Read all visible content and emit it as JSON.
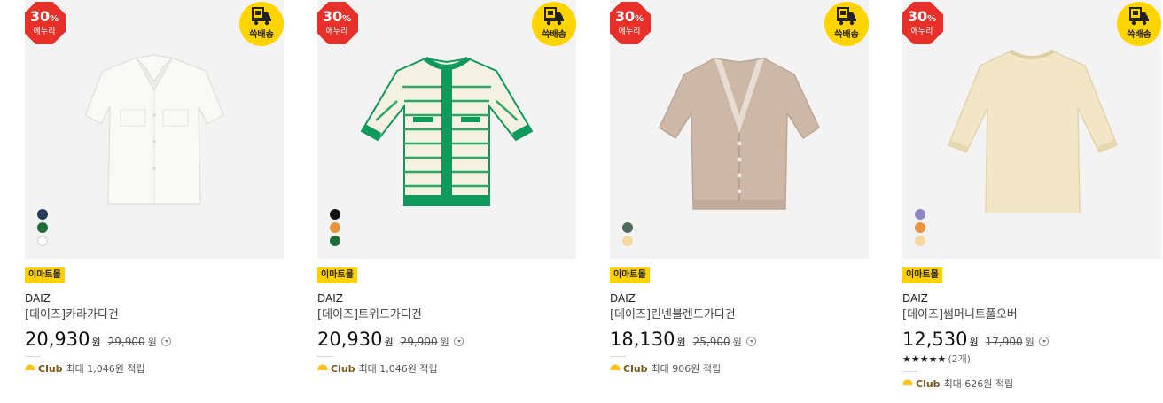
{
  "products": [
    {
      "sale_pct": "30",
      "sale_unit": "%",
      "sale_label": "에누리",
      "ship_label": "쓱배송",
      "mall_label": "이마트몰",
      "brand": "DAIZ",
      "name": "[데이즈]카라가디건",
      "price": "20,930",
      "currency": "원",
      "orig_price": "29,900",
      "orig_currency": "원",
      "rating_stars": "",
      "rating_count": "",
      "club_label": "Club",
      "club_text": "최대 1,046원 적립",
      "swatches": [
        "#243a5c",
        "#1f6e3a",
        "#ffffff"
      ],
      "garment_color": "#f8f8f6",
      "garment_icon": "white-shirt-cardigan"
    },
    {
      "sale_pct": "30",
      "sale_unit": "%",
      "sale_label": "에누리",
      "ship_label": "쓱배송",
      "mall_label": "이마트몰",
      "brand": "DAIZ",
      "name": "[데이즈]트위드가디건",
      "price": "20,930",
      "currency": "원",
      "orig_price": "29,900",
      "orig_currency": "원",
      "rating_stars": "",
      "rating_count": "",
      "club_label": "Club",
      "club_text": "최대 1,046원 적립",
      "swatches": [
        "#111111",
        "#e8933a",
        "#1f6e3a"
      ],
      "garment_color": "#f4f1e2",
      "garment_icon": "striped-tweed-cardigan"
    },
    {
      "sale_pct": "30",
      "sale_unit": "%",
      "sale_label": "에누리",
      "ship_label": "쓱배송",
      "mall_label": "이마트몰",
      "brand": "DAIZ",
      "name": "[데이즈]린넨블렌드가디건",
      "price": "18,130",
      "currency": "원",
      "orig_price": "25,900",
      "orig_currency": "원",
      "rating_stars": "",
      "rating_count": "",
      "club_label": "Club",
      "club_text": "최대 906원 적립",
      "swatches": [
        "#4f6b5d",
        "#f5d9a0"
      ],
      "garment_color": "#cdb8a8",
      "garment_icon": "linen-blend-cardigan"
    },
    {
      "sale_pct": "30",
      "sale_unit": "%",
      "sale_label": "에누리",
      "ship_label": "쓱배송",
      "mall_label": "이마트몰",
      "brand": "DAIZ",
      "name": "[데이즈]썸머니트풀오버",
      "price": "12,530",
      "currency": "원",
      "orig_price": "17,900",
      "orig_currency": "원",
      "rating_stars": "★★★★★",
      "rating_count": "(2개)",
      "club_label": "Club",
      "club_text": "최대 626원 적립",
      "swatches": [
        "#8c86c6",
        "#ea9440",
        "#f5d9a0"
      ],
      "garment_color": "#f2e6c6",
      "garment_icon": "knit-pullover"
    }
  ],
  "colors": {
    "sale_red": "#e8302a",
    "ship_yellow": "#ffd400",
    "mall_yellow": "#ffd100",
    "club_brown": "#7a5a1a",
    "accent_green": "#0f9a5c"
  }
}
